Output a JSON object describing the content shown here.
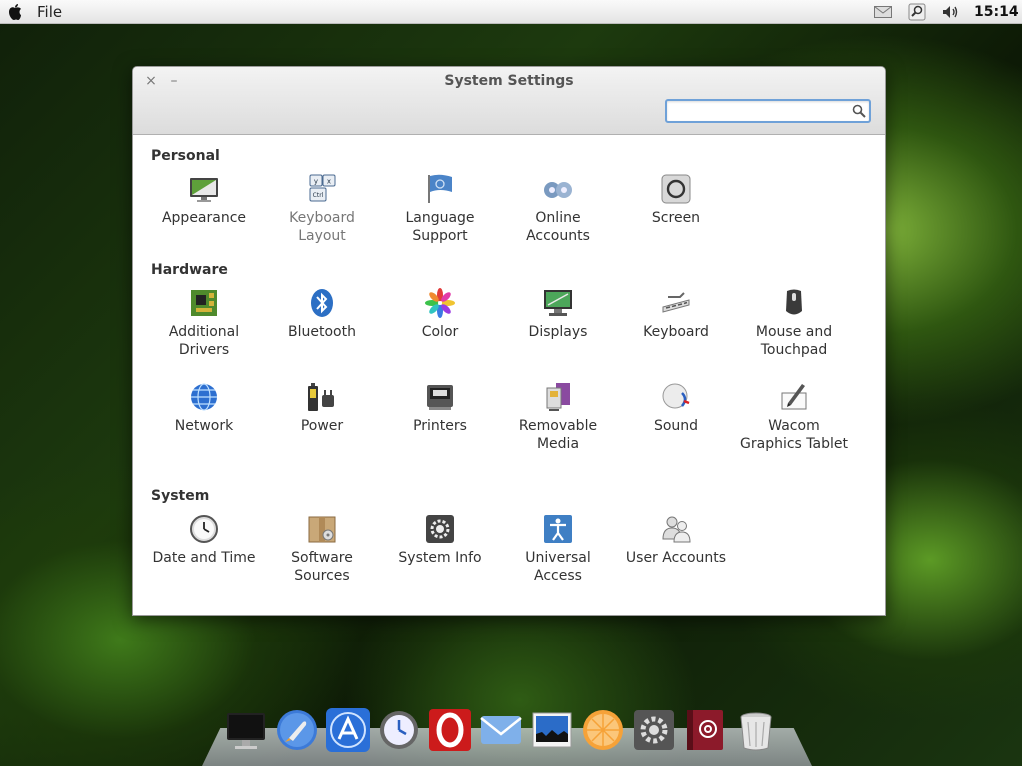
{
  "top_panel": {
    "menu_file": "File",
    "clock": "15:14"
  },
  "window": {
    "title": "System Settings",
    "close_glyph": "×",
    "minimize_glyph": "–",
    "search": {
      "value": "",
      "placeholder": ""
    }
  },
  "sections": {
    "personal": {
      "title": "Personal",
      "items": [
        {
          "label": "Appearance",
          "icon": "appearance-icon"
        },
        {
          "label": "Keyboard Layout",
          "icon": "keyboard-layout-icon"
        },
        {
          "label": "Language Support",
          "icon": "language-flag-icon"
        },
        {
          "label": "Online Accounts",
          "icon": "online-accounts-icon"
        },
        {
          "label": "Screen",
          "icon": "screen-lock-icon"
        }
      ]
    },
    "hardware": {
      "title": "Hardware",
      "items": [
        {
          "label": "Additional Drivers",
          "icon": "chip-board-icon"
        },
        {
          "label": "Bluetooth",
          "icon": "bluetooth-icon"
        },
        {
          "label": "Color",
          "icon": "color-wheel-icon"
        },
        {
          "label": "Displays",
          "icon": "display-monitor-icon"
        },
        {
          "label": "Keyboard",
          "icon": "keyboard-icon"
        },
        {
          "label": "Mouse and Touchpad",
          "icon": "mouse-icon"
        },
        {
          "label": "Network",
          "icon": "network-globe-icon"
        },
        {
          "label": "Power",
          "icon": "battery-plug-icon"
        },
        {
          "label": "Printers",
          "icon": "printer-icon"
        },
        {
          "label": "Removable Media",
          "icon": "removable-media-icon"
        },
        {
          "label": "Sound",
          "icon": "speaker-icon"
        },
        {
          "label": "Wacom Graphics Tablet",
          "icon": "tablet-pen-icon"
        }
      ]
    },
    "system": {
      "title": "System",
      "items": [
        {
          "label": "Date and Time",
          "icon": "clock-icon"
        },
        {
          "label": "Software Sources",
          "icon": "package-box-icon"
        },
        {
          "label": "System Info",
          "icon": "gear-info-icon"
        },
        {
          "label": "Universal Access",
          "icon": "accessibility-icon"
        },
        {
          "label": "User Accounts",
          "icon": "users-icon"
        }
      ]
    }
  },
  "dock": [
    {
      "icon": "monitor-finder-icon"
    },
    {
      "icon": "rocket-launcher-icon"
    },
    {
      "icon": "app-store-icon"
    },
    {
      "icon": "time-machine-icon"
    },
    {
      "icon": "opera-browser-icon"
    },
    {
      "icon": "mail-icon"
    },
    {
      "icon": "image-viewer-icon"
    },
    {
      "icon": "orange-media-icon"
    },
    {
      "icon": "system-settings-icon"
    },
    {
      "icon": "address-book-icon"
    },
    {
      "icon": "trash-icon"
    }
  ],
  "colors": {
    "search_border": "#6fa1d8",
    "opera_red": "#cc1b1b",
    "address_book": "#8c1a2a"
  }
}
